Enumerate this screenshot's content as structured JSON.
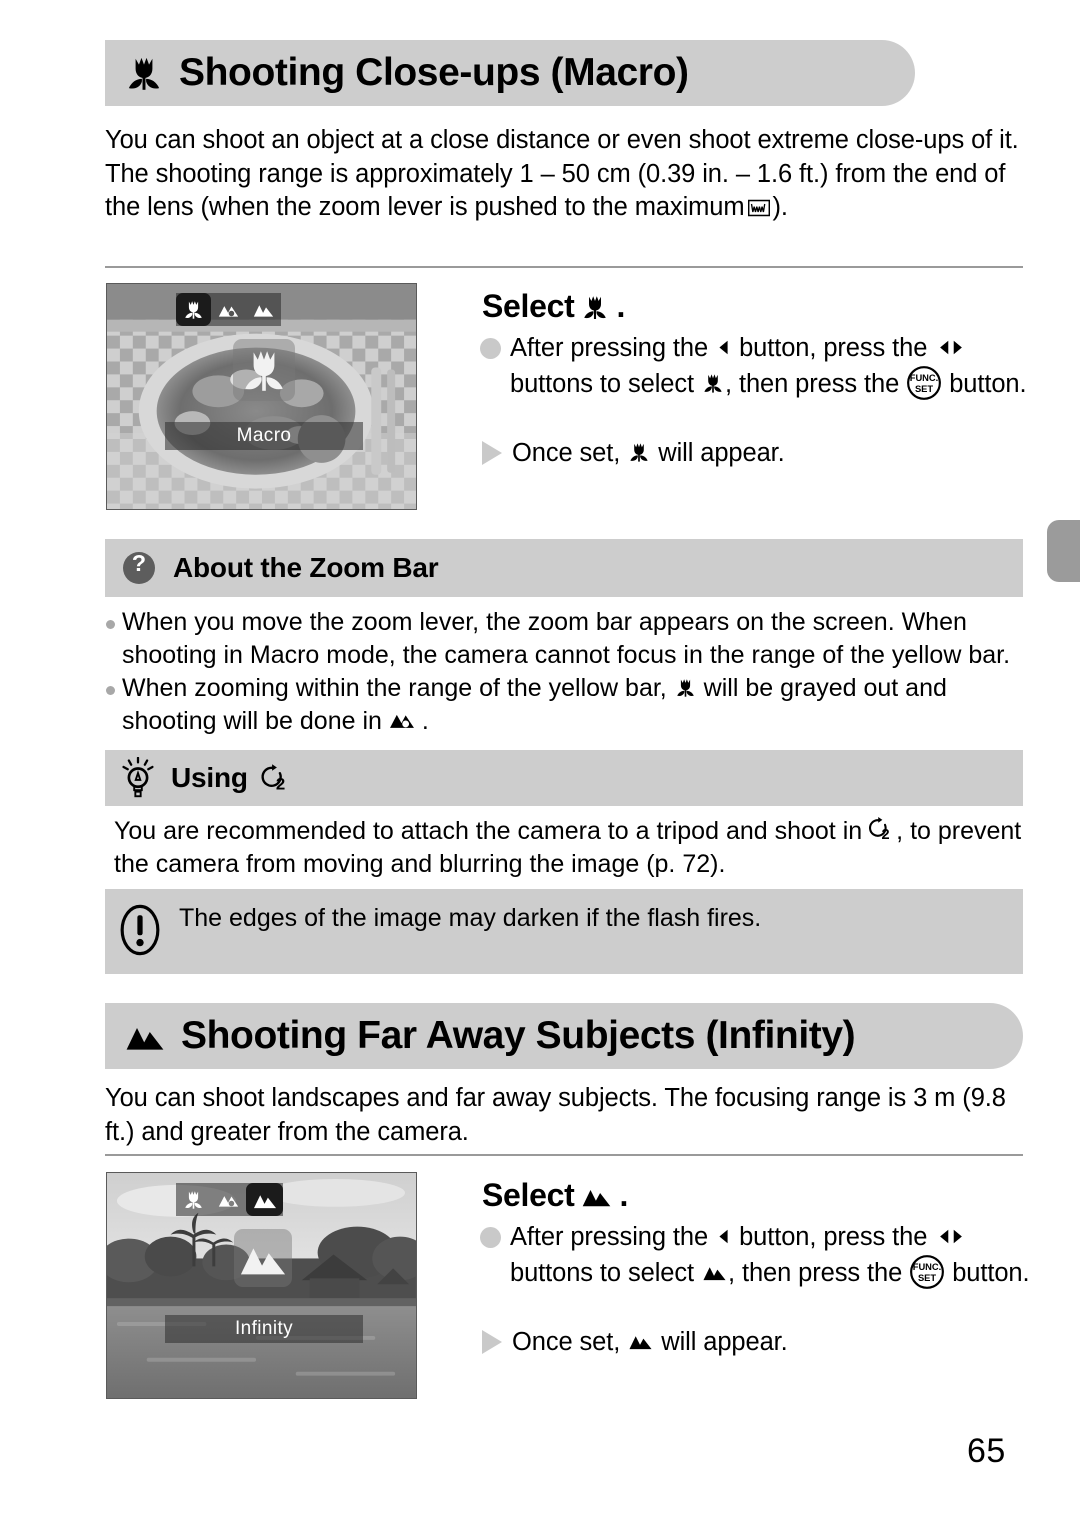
{
  "page_number": "65",
  "sections": [
    {
      "id": "macro",
      "icon": "macro-tulip-icon",
      "title": "Shooting Close-ups (Macro)",
      "intro": "You can shoot an object at a close distance or even shoot extreme close-ups of it. The shooting range is approximately 1 – 50 cm (0.39 in. – 1.6 ft.) from the end of the lens (when the zoom lever is pushed to the maximum",
      "intro_tail": ").",
      "intro_icon": "wide-angle-zoom-icon",
      "screenshot": {
        "name": "macro-camera-screen",
        "mode_label": "Macro",
        "menu_icons": [
          "macro-tulip-icon",
          "auto-focus-icon",
          "infinity-mountain-icon"
        ],
        "selected_index": 0,
        "overlay_icon": "macro-tulip-icon"
      },
      "step": {
        "heading_prefix": "Select",
        "heading_icon": "macro-tulip-icon",
        "heading_suffix": ".",
        "bullet_parts": [
          "After pressing the",
          "button, press the",
          "buttons to select",
          ", then press the",
          "button."
        ],
        "arrow_parts": [
          "Once set,",
          "will appear."
        ]
      }
    },
    {
      "id": "infinity",
      "icon": "infinity-mountain-icon",
      "title": "Shooting Far Away Subjects (Infinity)",
      "intro": "You can shoot landscapes and far away subjects. The focusing range is 3 m (9.8 ft.) and greater from the camera.",
      "screenshot": {
        "name": "infinity-camera-screen",
        "mode_label": "Infinity",
        "menu_icons": [
          "macro-tulip-icon",
          "auto-focus-icon",
          "infinity-mountain-icon"
        ],
        "selected_index": 2,
        "overlay_icon": "infinity-mountain-icon"
      },
      "step": {
        "heading_prefix": "Select",
        "heading_icon": "infinity-mountain-icon",
        "heading_suffix": ".",
        "bullet_parts": [
          "After pressing the",
          "button, press the",
          "buttons to select",
          ", then press the",
          "button."
        ],
        "arrow_parts": [
          "Once set,",
          "will appear."
        ]
      }
    }
  ],
  "zoom_bar_box": {
    "icon": "question-mark-icon",
    "title": "About the Zoom Bar",
    "items": [
      {
        "part1": "When you move the zoom lever, the zoom bar appears on the screen. When shooting in Macro mode, the camera cannot focus in the range of the yellow bar."
      },
      {
        "part1": "When zooming within the range of the yellow bar,",
        "icon1": "macro-tulip-icon",
        "part2": "will be grayed out and shooting will be done in",
        "icon2": "auto-focus-icon",
        "part3": "."
      }
    ]
  },
  "tip_box": {
    "icon": "lightbulb-icon",
    "title_prefix": "Using",
    "title_icon": "self-timer-2sec-icon",
    "body_part1": "You are recommended to attach the camera to a tripod and shoot in",
    "body_icon": "self-timer-2sec-icon",
    "body_part2": ", to prevent the camera from moving and blurring the image (p. 72)."
  },
  "caution_box": {
    "icon": "exclamation-icon",
    "text": "The edges of the image may darken if the flash fires."
  },
  "colors": {
    "banner_gray": "#cdcdcd",
    "bullet_gray": "#c9c9c9",
    "rule_gray": "#9a9a9a",
    "tab_gray": "#9b9b9b",
    "icon_dark": "#595959"
  }
}
